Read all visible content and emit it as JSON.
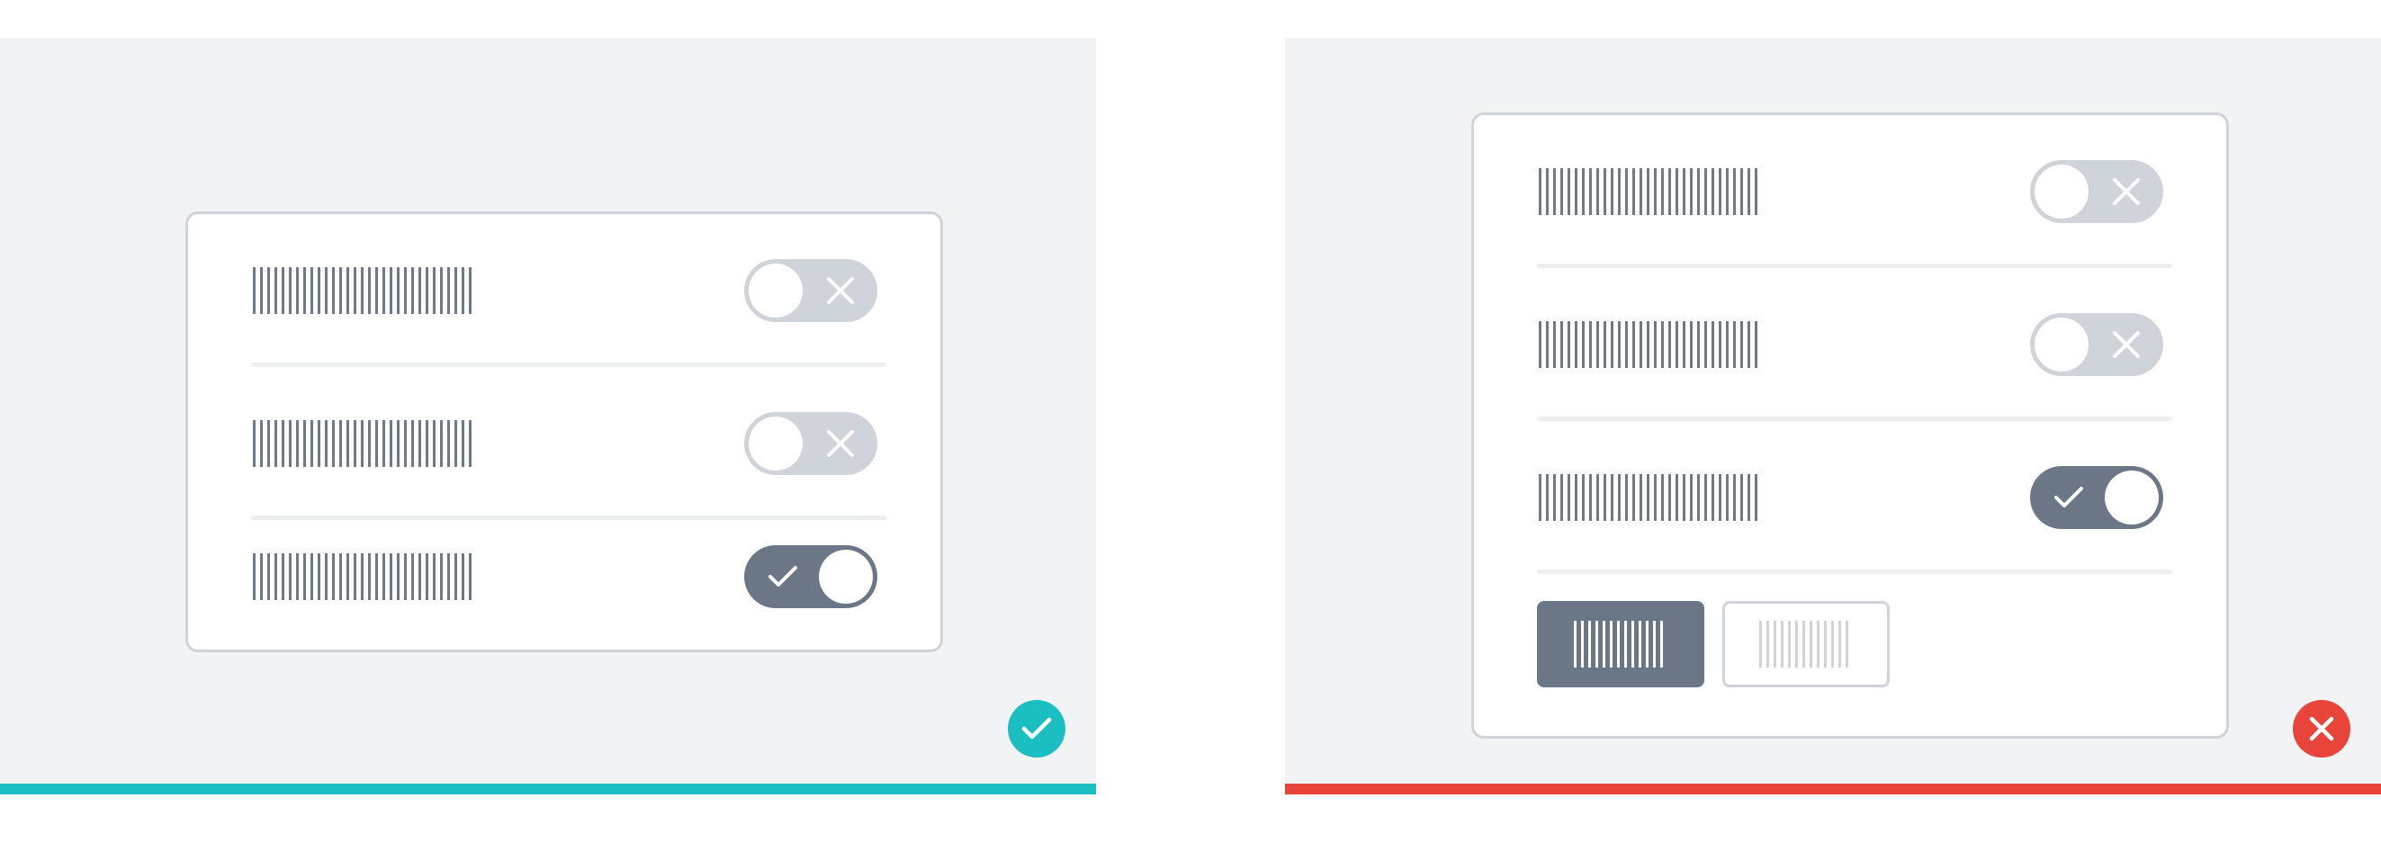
{
  "colors": {
    "panel_background": "#f1f3f5",
    "card_border": "#ced4da",
    "label_placeholder": "#6d7a8a",
    "toggle_off": "#ced4da",
    "toggle_on": "#6b7787",
    "correct_accent": "#1bbfc1",
    "incorrect_accent": "#e8443a"
  },
  "good_example": {
    "verdict": "correct",
    "verdict_icon": "check-icon",
    "rows": [
      {
        "toggle_state": "off",
        "toggle_icon": "close-icon"
      },
      {
        "toggle_state": "off",
        "toggle_icon": "close-icon"
      },
      {
        "toggle_state": "on",
        "toggle_icon": "check-icon"
      }
    ]
  },
  "bad_example": {
    "verdict": "incorrect",
    "verdict_icon": "close-icon",
    "rows": [
      {
        "toggle_state": "off",
        "toggle_icon": "close-icon"
      },
      {
        "toggle_state": "off",
        "toggle_icon": "close-icon"
      },
      {
        "toggle_state": "on",
        "toggle_icon": "check-icon"
      }
    ],
    "buttons": [
      {
        "variant": "primary"
      },
      {
        "variant": "secondary"
      }
    ]
  }
}
